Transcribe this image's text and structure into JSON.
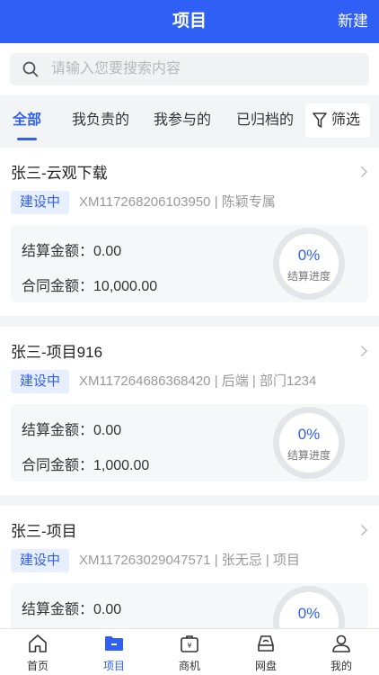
{
  "header": {
    "title": "项目",
    "new_label": "新建"
  },
  "search": {
    "placeholder": "请输入您要搜索内容"
  },
  "tabs": [
    {
      "label": "全部",
      "active": true
    },
    {
      "label": "我负责的",
      "active": false
    },
    {
      "label": "我参与的",
      "active": false
    },
    {
      "label": "已归档的",
      "active": false
    }
  ],
  "filter": {
    "label": "筛选"
  },
  "projects": [
    {
      "name": "张三-云观下载",
      "status": "建设中",
      "code_line": "XM117268206103950 | 陈颖专属",
      "settled_label": "结算金额：",
      "settled_value": "0.00",
      "contract_label": "合同金额：",
      "contract_value": "10,000.00",
      "progress_text": "0%",
      "progress_label": "结算进度",
      "progress": 0
    },
    {
      "name": "张三-项目916",
      "status": "建设中",
      "code_line": "XM117264686368420 | 后端 | 部门1234",
      "settled_label": "结算金额：",
      "settled_value": "0.00",
      "contract_label": "合同金额：",
      "contract_value": "1,000.00",
      "progress_text": "0%",
      "progress_label": "结算进度",
      "progress": 0
    },
    {
      "name": "张三-项目",
      "status": "建设中",
      "code_line": "XM117263029047571 | 张无忌 | 项目",
      "settled_label": "结算金额：",
      "settled_value": "0.00",
      "progress_text": "0%",
      "progress": 0
    }
  ],
  "nav": [
    {
      "label": "首页",
      "icon": "home-icon",
      "active": false
    },
    {
      "label": "项目",
      "icon": "folder-icon",
      "active": true
    },
    {
      "label": "商机",
      "icon": "briefcase-icon",
      "active": false
    },
    {
      "label": "网盘",
      "icon": "cloud-drive-icon",
      "active": false
    },
    {
      "label": "我的",
      "icon": "user-icon",
      "active": false
    }
  ],
  "colors": {
    "primary": "#2f5ff5",
    "badge_bg": "#e7efff",
    "page_bg": "#f3f4f6"
  }
}
